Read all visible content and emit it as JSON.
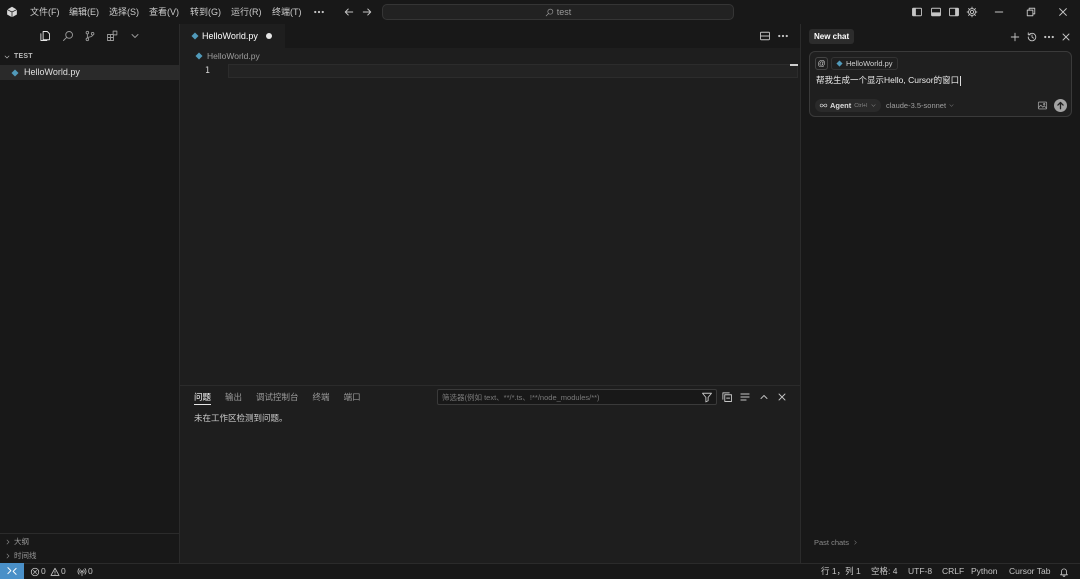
{
  "titlebar": {
    "menu": [
      "文件(F)",
      "编辑(E)",
      "选择(S)",
      "查看(V)",
      "转到(G)",
      "运行(R)",
      "终端(T)"
    ],
    "search_text": "test"
  },
  "sidebar": {
    "section_title": "TEST",
    "files": [
      {
        "name": "HelloWorld.py",
        "icon": "python-file-icon"
      }
    ],
    "bottom_sections": [
      "大纲",
      "时间线"
    ]
  },
  "editor": {
    "tab": {
      "label": "HelloWorld.py",
      "modified": true
    },
    "breadcrumb": "HelloWorld.py",
    "lines": [
      {
        "number": "1"
      }
    ]
  },
  "panel": {
    "tabs": [
      "问题",
      "输出",
      "调试控制台",
      "终端",
      "端口"
    ],
    "active_tab": "问题",
    "filter_placeholder": "筛选器(例如 text、**/*.ts、!**/node_modules/**)",
    "message": "未在工作区检测到问题。"
  },
  "chat": {
    "title": "New chat",
    "mention_symbol": "@",
    "context_file": "HelloWorld.py",
    "input_text": "帮我生成一个显示Hello, Cursor的窗口",
    "mode_label": "Agent",
    "mode_shortcut": "Ctrl+I",
    "model": "claude-3.5-sonnet",
    "past_chats": "Past chats"
  },
  "statusbar": {
    "errors": "0",
    "warnings": "0",
    "ports": "0",
    "position": "行 1，列 1",
    "indent": "空格: 4",
    "encoding": "UTF-8",
    "eol": "CRLF",
    "language": "Python",
    "cursor_tab": "Cursor Tab"
  },
  "theme": {
    "accent": "#4a90c8",
    "python_icon": "#519aba"
  }
}
